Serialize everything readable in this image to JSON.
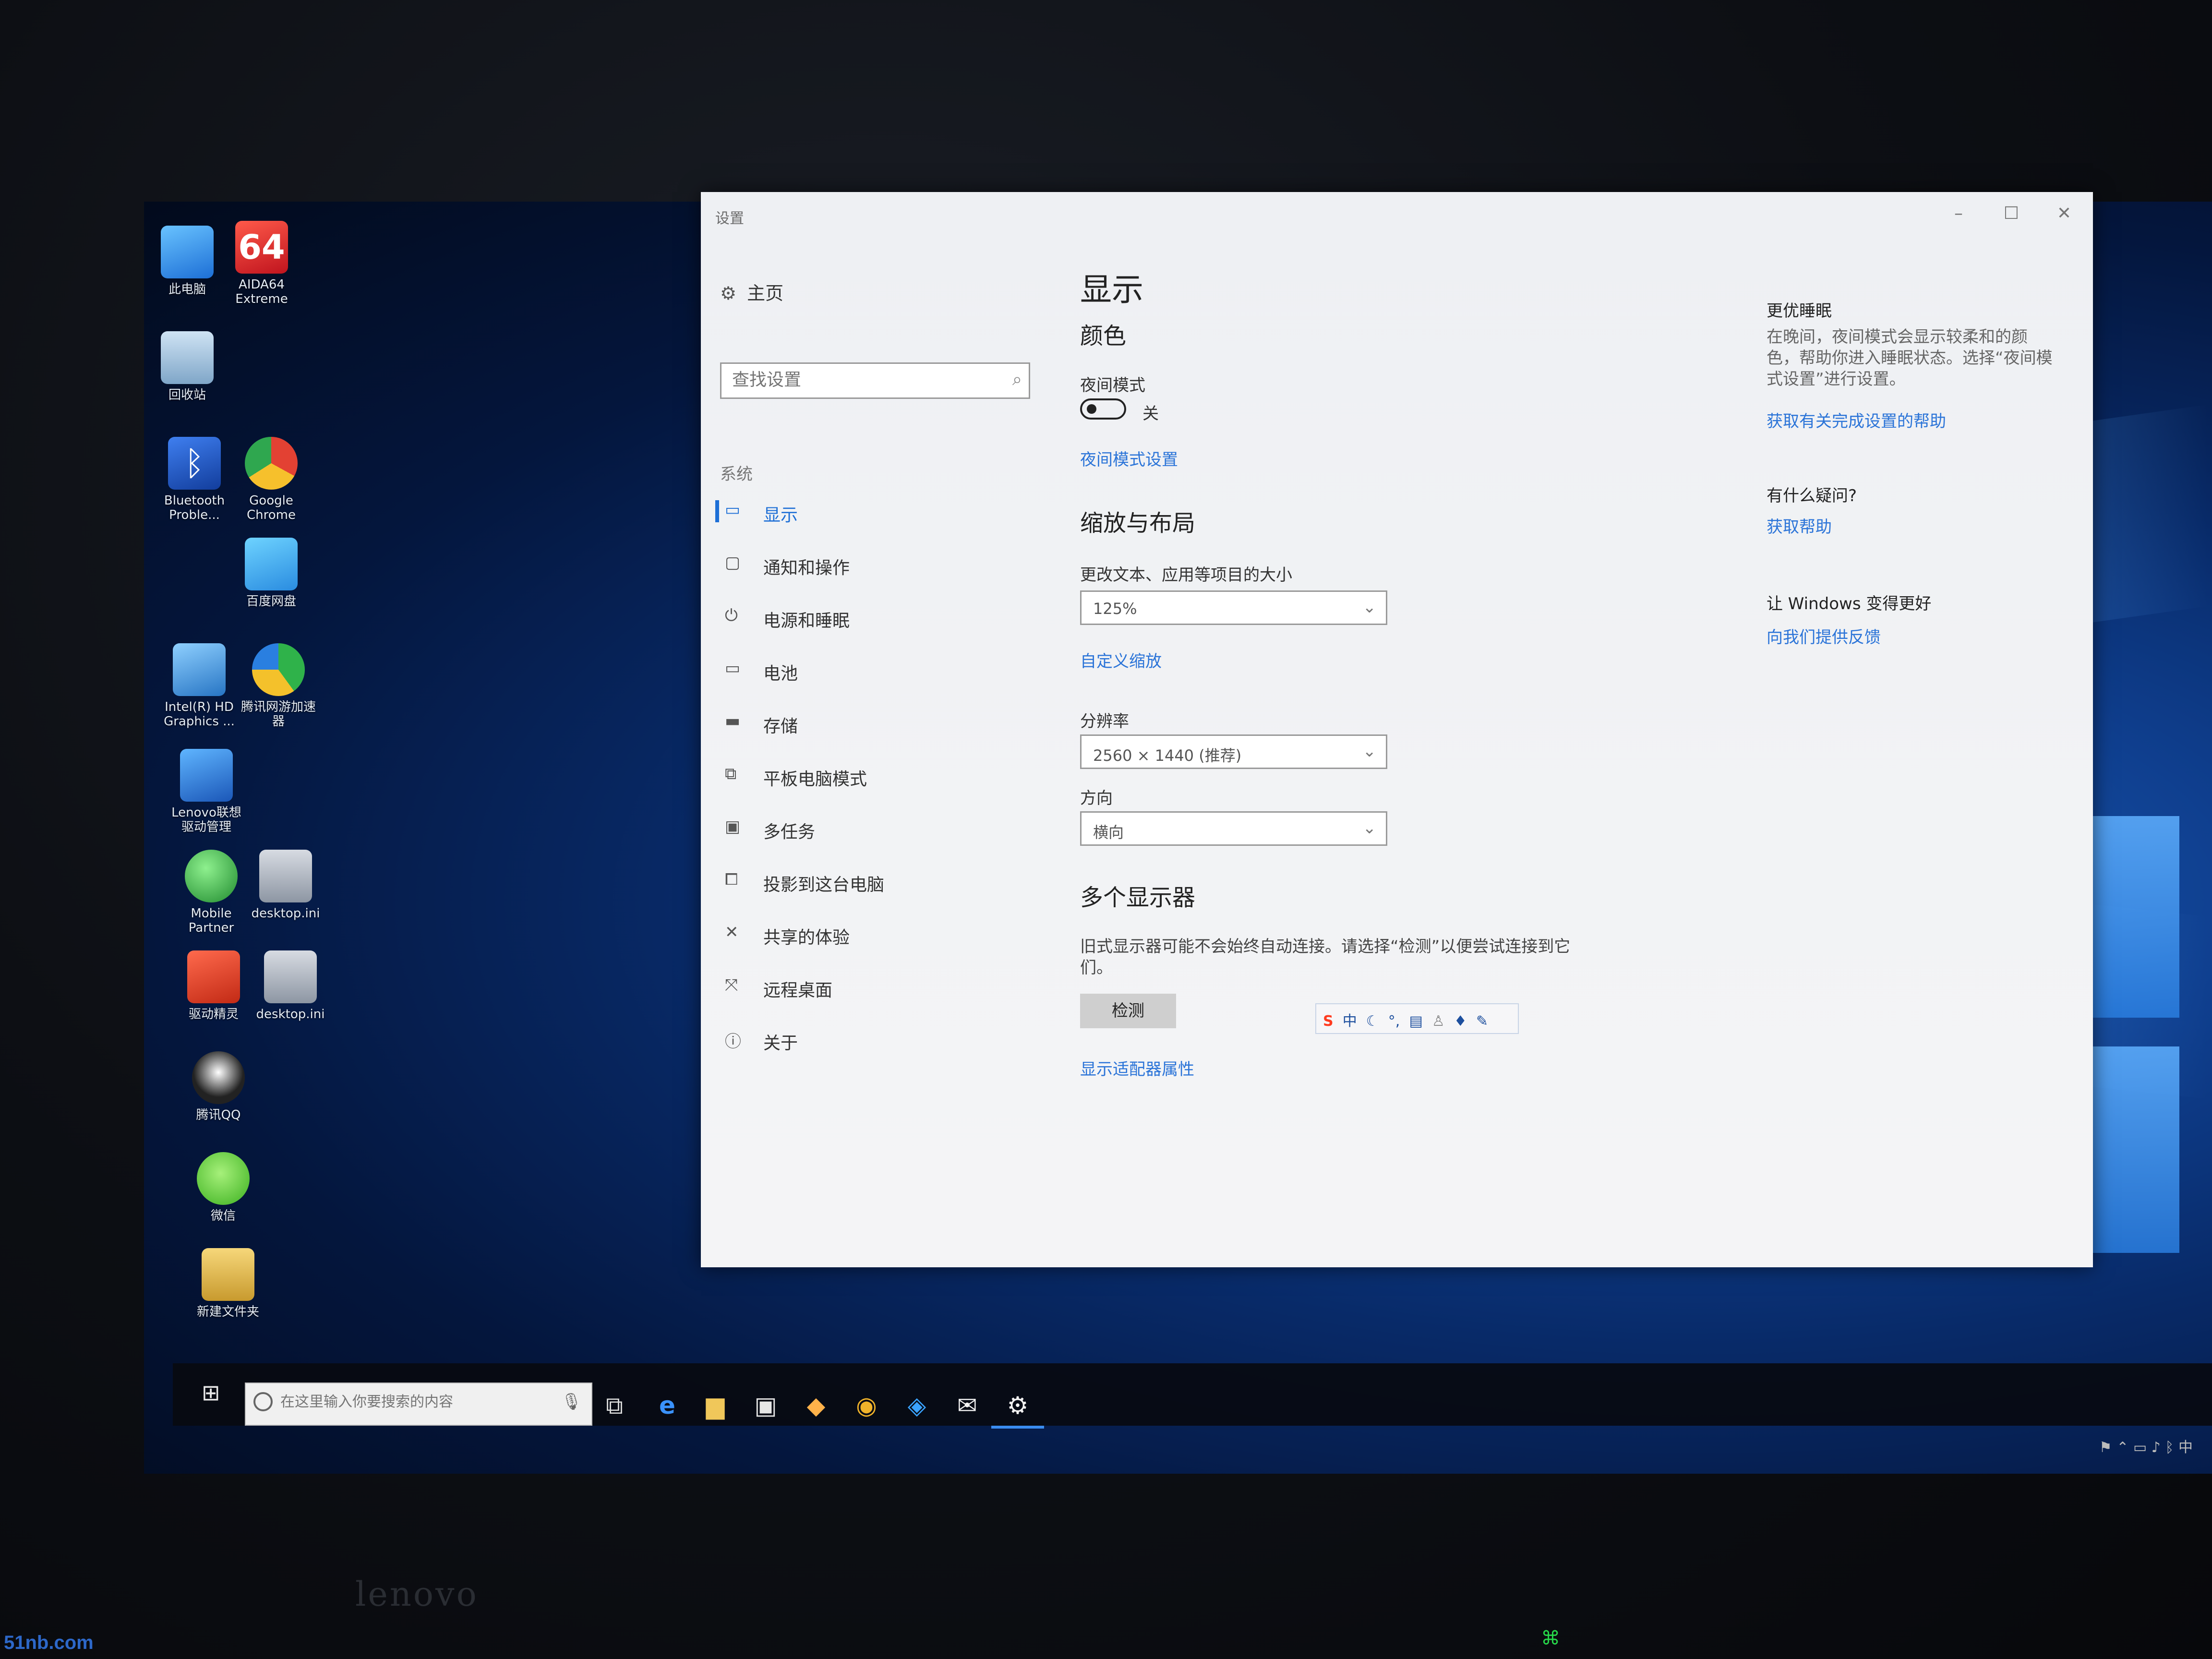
{
  "desktop": {
    "icons": [
      {
        "label": "此电脑",
        "icon": "computer-icon"
      },
      {
        "label": "AIDA64 Extreme",
        "icon": "aida64-icon"
      },
      {
        "label": "回收站",
        "icon": "recycle-bin-icon"
      },
      {
        "label": "Bluetooth Proble...",
        "icon": "bluetooth-icon"
      },
      {
        "label": "Google Chrome",
        "icon": "chrome-icon"
      },
      {
        "label": "百度网盘",
        "icon": "baidu-netdisk-icon"
      },
      {
        "label": "Intel(R) HD Graphics ...",
        "icon": "intel-graphics-icon"
      },
      {
        "label": "腾讯网游加速器",
        "icon": "tencent-accelerator-icon"
      },
      {
        "label": "Lenovo联想驱动管理",
        "icon": "lenovo-driver-icon"
      },
      {
        "label": "Mobile Partner",
        "icon": "mobile-partner-icon"
      },
      {
        "label": "desktop.ini",
        "icon": "ini-file-icon"
      },
      {
        "label": "驱动精灵",
        "icon": "driver-genius-icon"
      },
      {
        "label": "desktop.ini",
        "icon": "ini-file-icon"
      },
      {
        "label": "腾讯QQ",
        "icon": "qq-icon"
      },
      {
        "label": "微信",
        "icon": "wechat-icon"
      },
      {
        "label": "新建文件夹",
        "icon": "folder-icon"
      }
    ]
  },
  "settings": {
    "window_title": "设置",
    "controls": {
      "minimize": "–",
      "maximize": "☐",
      "close": "✕"
    },
    "sidebar": {
      "home_label": "主页",
      "search_placeholder": "查找设置",
      "group_label": "系统",
      "items": [
        {
          "label": "显示",
          "active": true
        },
        {
          "label": "通知和操作"
        },
        {
          "label": "电源和睡眠"
        },
        {
          "label": "电池"
        },
        {
          "label": "存储"
        },
        {
          "label": "平板电脑模式"
        },
        {
          "label": "多任务"
        },
        {
          "label": "投影到这台电脑"
        },
        {
          "label": "共享的体验"
        },
        {
          "label": "远程桌面"
        },
        {
          "label": "关于"
        }
      ]
    },
    "main": {
      "page_title": "显示",
      "color_section": "颜色",
      "night_mode_label": "夜间模式",
      "night_mode_state": "关",
      "night_mode_on": false,
      "night_mode_link": "夜间模式设置",
      "scale_section": "缩放与布局",
      "scale_label": "更改文本、应用等项目的大小",
      "scale_value": "125%",
      "custom_scale_link": "自定义缩放",
      "resolution_label": "分辨率",
      "resolution_value": "2560 × 1440 (推荐)",
      "orientation_label": "方向",
      "orientation_value": "横向",
      "multi_display_section": "多个显示器",
      "multi_display_text": "旧式显示器可能不会始终自动连接。请选择“检测”以便尝试连接到它们。",
      "detect_button": "检测",
      "adapter_link": "显示适配器属性"
    },
    "help_panel": {
      "sleep_title": "更优睡眠",
      "sleep_text": "在晚间，夜间模式会显示较柔和的颜色，帮助你进入睡眠状态。选择“夜间模式设置”进行设置。",
      "sleep_link": "获取有关完成设置的帮助",
      "question_title": "有什么疑问?",
      "question_link": "获取帮助",
      "improve_title": "让 Windows 变得更好",
      "improve_link": "向我们提供反馈"
    },
    "ime_bar": {
      "logo": "S",
      "mode": "中"
    }
  },
  "taskbar": {
    "search_placeholder": "在这里输入你要搜索的内容",
    "apps": [
      "task-view-icon",
      "edge-icon",
      "file-explorer-icon",
      "store-icon",
      "media-icon",
      "chrome-icon",
      "baidu-netdisk-icon",
      "mail-icon",
      "settings-gear-icon"
    ]
  },
  "hardware": {
    "brand": "lenovo",
    "watermark": "51nb.com"
  },
  "colors": {
    "accent": "#1d6fd6",
    "link": "#2b74d8"
  }
}
